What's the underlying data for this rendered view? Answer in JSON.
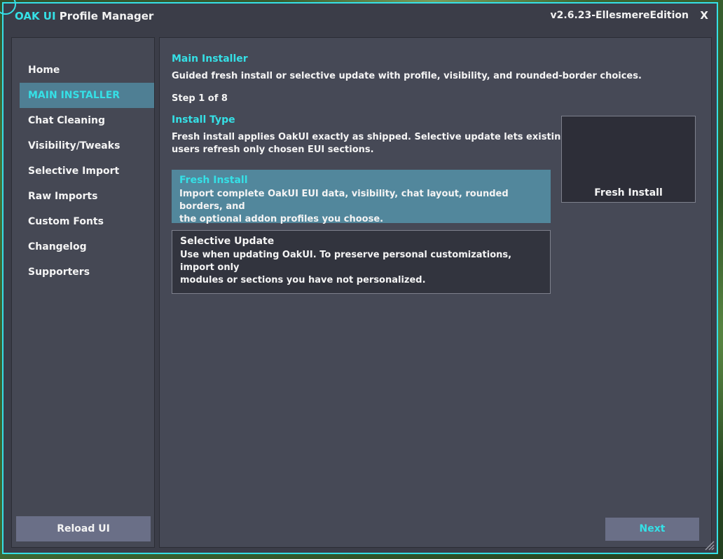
{
  "window": {
    "title_brand": "OAK UI",
    "title_rest": " Profile Manager",
    "version": "v2.6.23-EllesmereEdition",
    "close_label": "X"
  },
  "sidebar": {
    "items": [
      {
        "label": "Home",
        "active": false
      },
      {
        "label": "MAIN INSTALLER",
        "active": true
      },
      {
        "label": "Chat Cleaning",
        "active": false
      },
      {
        "label": "Visibility/Tweaks",
        "active": false
      },
      {
        "label": "Selective Import",
        "active": false
      },
      {
        "label": "Raw Imports",
        "active": false
      },
      {
        "label": "Custom Fonts",
        "active": false
      },
      {
        "label": "Changelog",
        "active": false
      },
      {
        "label": "Supporters",
        "active": false
      }
    ],
    "reload_label": "Reload UI"
  },
  "main": {
    "title": "Main Installer",
    "subtitle": "Guided fresh install or selective update with profile, visibility, and rounded-border choices.",
    "step": "Step 1 of 8",
    "section_title": "Install Type",
    "section_desc_line1": "Fresh install applies OakUI exactly as shipped. Selective update lets existing",
    "section_desc_line2": "users refresh only chosen EUI sections.",
    "options": [
      {
        "title": "Fresh Install",
        "desc_line1": "Import complete OakUI EUI data, visibility, chat layout, rounded borders, and",
        "desc_line2": "the optional addon profiles you choose.",
        "selected": true
      },
      {
        "title": "Selective Update",
        "desc_line1": "Use when updating OakUI. To preserve personal customizations, import only",
        "desc_line2": "modules or sections you have not personalized.",
        "selected": false
      }
    ],
    "preview_label": "Fresh Install",
    "next_label": "Next"
  },
  "colors": {
    "accent": "#35e0e6",
    "window_bg": "#3b3d48",
    "panel_bg": "#464956",
    "selected_bg": "#52879c",
    "button_bg": "#6a6f87"
  }
}
